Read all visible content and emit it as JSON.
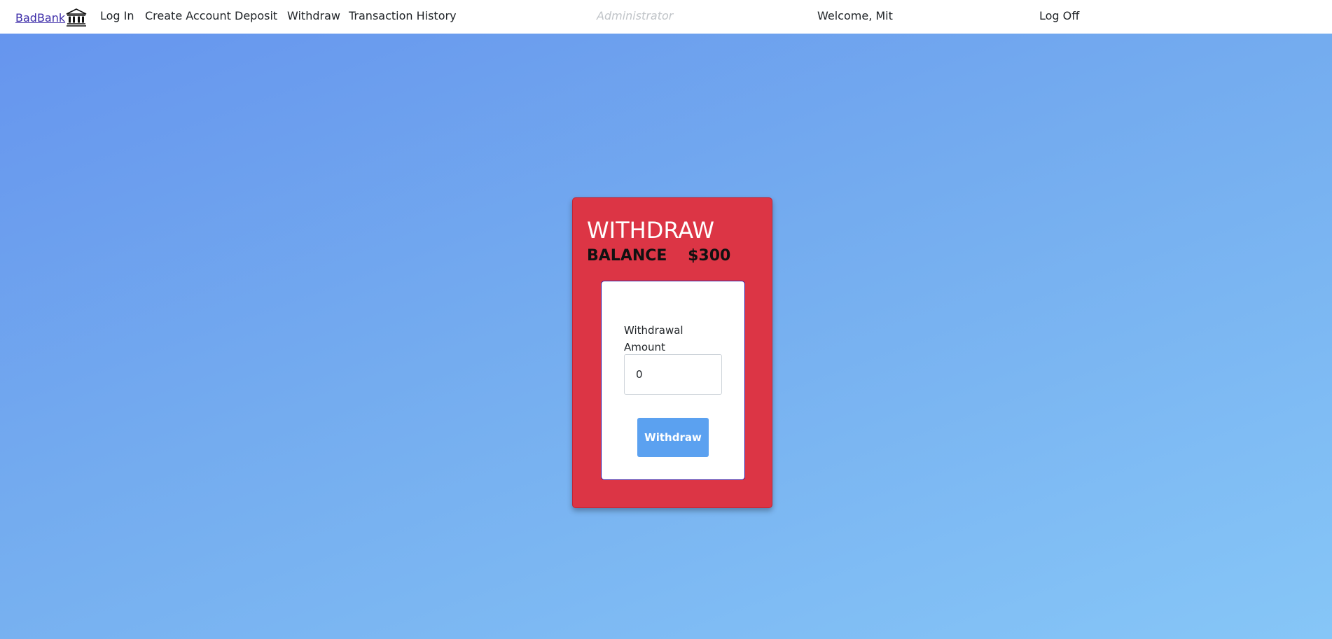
{
  "nav": {
    "brand": "BadBank",
    "brand_icon": "bank-building-icon",
    "login": "Log In",
    "create_account": "Create Account",
    "deposit": "Deposit",
    "withdraw": "Withdraw",
    "transaction_history": "Transaction History",
    "admin": "Administrator",
    "welcome": "Welcome, Mit",
    "logoff": "Log Off"
  },
  "card": {
    "title": "WITHDRAW",
    "balance_label": "BALANCE",
    "balance_value": "$300",
    "field_label": "Withdrawal Amount",
    "field_value": "0",
    "submit_label": "Withdraw"
  },
  "colors": {
    "card_bg": "#dc3545",
    "button_bg": "#5ba1f0",
    "gradient_start": "#6695ee",
    "gradient_end": "#86c6f7"
  }
}
